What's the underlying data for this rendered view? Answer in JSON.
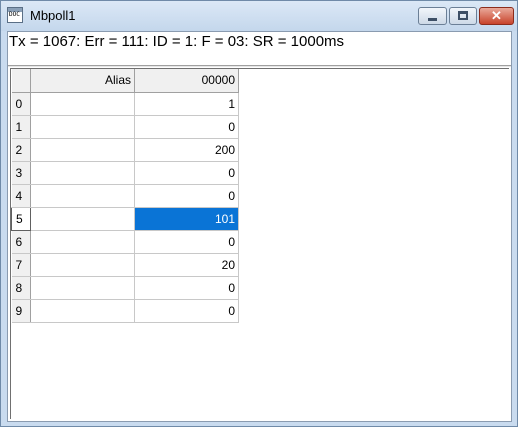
{
  "window": {
    "title": "Mbpoll1",
    "icon": "doc-icon",
    "icon_text": "DOC",
    "controls": {
      "minimize": "minimize-icon",
      "maximize": "maximize-icon",
      "close": "close-icon",
      "close_glyph": "✕"
    }
  },
  "status": {
    "line": "Tx = 1067: Err = 111: ID = 1: F = 03: SR = 1000ms"
  },
  "grid": {
    "headers": {
      "alias": "Alias",
      "value": "00000"
    },
    "rows": [
      {
        "index": "0",
        "alias": "",
        "value": "1"
      },
      {
        "index": "1",
        "alias": "",
        "value": "0"
      },
      {
        "index": "2",
        "alias": "",
        "value": "200"
      },
      {
        "index": "3",
        "alias": "",
        "value": "0"
      },
      {
        "index": "4",
        "alias": "",
        "value": "0"
      },
      {
        "index": "5",
        "alias": "",
        "value": "101"
      },
      {
        "index": "6",
        "alias": "",
        "value": "0"
      },
      {
        "index": "7",
        "alias": "",
        "value": "20"
      },
      {
        "index": "8",
        "alias": "",
        "value": "0"
      },
      {
        "index": "9",
        "alias": "",
        "value": "0"
      }
    ],
    "selected_row": 5,
    "selection_color": "#0a74d6"
  }
}
